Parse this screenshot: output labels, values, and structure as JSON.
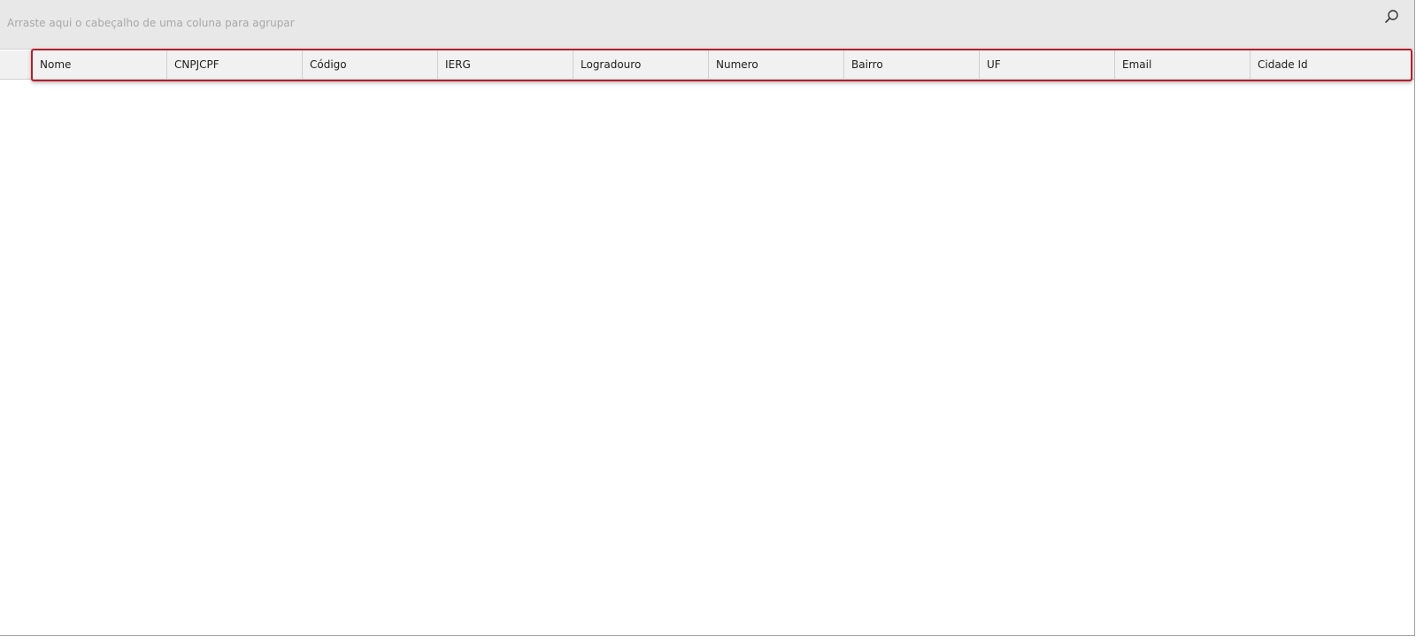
{
  "group_panel": {
    "hint": "Arraste aqui o cabeçalho de uma coluna para agrupar",
    "search_icon": "search-icon"
  },
  "columns": [
    {
      "label": "Nome"
    },
    {
      "label": "CNPJCPF"
    },
    {
      "label": "Código"
    },
    {
      "label": "IERG"
    },
    {
      "label": "Logradouro"
    },
    {
      "label": "Numero"
    },
    {
      "label": "Bairro"
    },
    {
      "label": "UF"
    },
    {
      "label": "Email"
    },
    {
      "label": "Cidade Id"
    }
  ],
  "rows": [],
  "colors": {
    "highlight": "#b3202e",
    "group_panel_bg": "#e8e8e8",
    "header_bg": "#f1f1f1"
  }
}
